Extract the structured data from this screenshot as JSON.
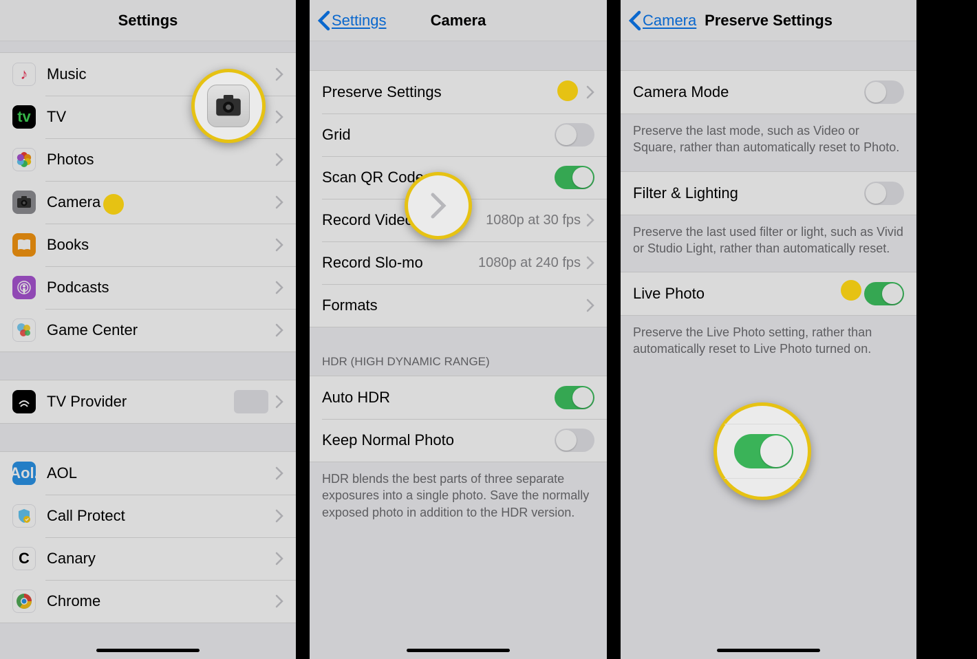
{
  "screen1": {
    "title": "Settings",
    "group1": [
      {
        "icon": "music-icon",
        "label": "Music"
      },
      {
        "icon": "tv-icon",
        "label": "TV"
      },
      {
        "icon": "photos-icon",
        "label": "Photos"
      },
      {
        "icon": "camera-icon",
        "label": "Camera"
      },
      {
        "icon": "books-icon",
        "label": "Books"
      },
      {
        "icon": "podcasts-icon",
        "label": "Podcasts"
      },
      {
        "icon": "gamecenter-icon",
        "label": "Game Center"
      }
    ],
    "group2": [
      {
        "icon": "tvprovider-icon",
        "label": "TV Provider"
      }
    ],
    "group3": [
      {
        "icon": "aol-icon",
        "label": "AOL"
      },
      {
        "icon": "callprotect-icon",
        "label": "Call Protect"
      },
      {
        "icon": "canary-icon",
        "label": "Canary"
      },
      {
        "icon": "chrome-icon",
        "label": "Chrome"
      }
    ]
  },
  "screen2": {
    "back": "Settings",
    "title": "Camera",
    "group1": [
      {
        "label": "Preserve Settings",
        "type": "nav"
      },
      {
        "label": "Grid",
        "type": "toggle",
        "on": false
      },
      {
        "label": "Scan QR Codes",
        "type": "toggle",
        "on": true
      },
      {
        "label": "Record Video",
        "type": "nav",
        "value": "1080p at 30 fps"
      },
      {
        "label": "Record Slo-mo",
        "type": "nav",
        "value": "1080p at 240 fps"
      },
      {
        "label": "Formats",
        "type": "nav"
      }
    ],
    "hdr_header": "HDR (HIGH DYNAMIC RANGE)",
    "group2": [
      {
        "label": "Auto HDR",
        "type": "toggle",
        "on": true
      },
      {
        "label": "Keep Normal Photo",
        "type": "toggle",
        "on": false
      }
    ],
    "hdr_footer": "HDR blends the best parts of three separate exposures into a single photo. Save the normally exposed photo in addition to the HDR version."
  },
  "screen3": {
    "back": "Camera",
    "title": "Preserve Settings",
    "items": [
      {
        "label": "Camera Mode",
        "on": false,
        "footer": "Preserve the last mode, such as Video or Square, rather than automatically reset to Photo."
      },
      {
        "label": "Filter & Lighting",
        "on": false,
        "footer": "Preserve the last used filter or light, such as Vivid or Studio Light, rather than automatically reset."
      },
      {
        "label": "Live Photo",
        "on": true,
        "footer": "Preserve the Live Photo setting, rather than automatically reset to Live Photo turned on."
      }
    ]
  }
}
